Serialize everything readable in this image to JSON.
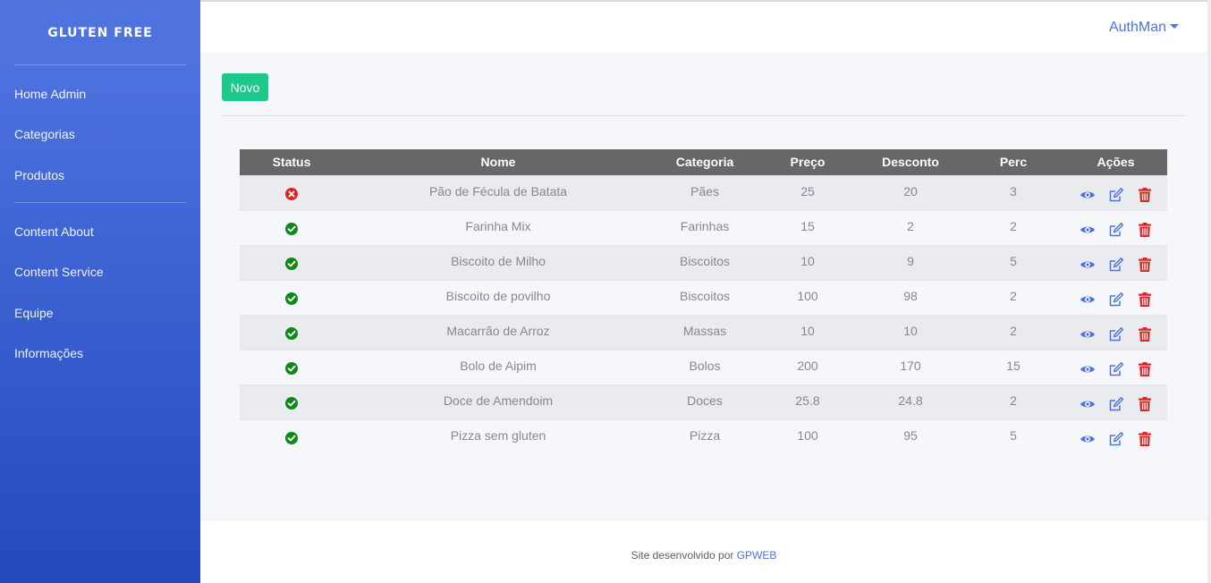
{
  "brand": "GLUTEN FREE",
  "sidebar": {
    "items": [
      {
        "label": "Home Admin"
      },
      {
        "label": "Categorias"
      },
      {
        "label": "Produtos"
      },
      {
        "label": "Content About"
      },
      {
        "label": "Content Service"
      },
      {
        "label": "Equipe"
      },
      {
        "label": "Informações"
      }
    ]
  },
  "topbar": {
    "user": "AuthMan"
  },
  "toolbar": {
    "new_label": "Novo"
  },
  "table": {
    "columns": [
      "Status",
      "Nome",
      "Categoria",
      "Preço",
      "Desconto",
      "Perc",
      "Ações"
    ],
    "rows": [
      {
        "status": "inactive",
        "nome": "Pão de Fécula de Batata",
        "categoria": "Pães",
        "preco": "25",
        "desconto": "20",
        "perc": "3"
      },
      {
        "status": "active",
        "nome": "Farinha Mix",
        "categoria": "Farinhas",
        "preco": "15",
        "desconto": "2",
        "perc": "2"
      },
      {
        "status": "active",
        "nome": "Biscoito de Milho",
        "categoria": "Biscoitos",
        "preco": "10",
        "desconto": "9",
        "perc": "5"
      },
      {
        "status": "active",
        "nome": "Biscoito de povilho",
        "categoria": "Biscoitos",
        "preco": "100",
        "desconto": "98",
        "perc": "2"
      },
      {
        "status": "active",
        "nome": "Macarrão de Arroz",
        "categoria": "Massas",
        "preco": "10",
        "desconto": "10",
        "perc": "2"
      },
      {
        "status": "active",
        "nome": "Bolo de Aipim",
        "categoria": "Bolos",
        "preco": "200",
        "desconto": "170",
        "perc": "15"
      },
      {
        "status": "active",
        "nome": "Doce de Amendoim",
        "categoria": "Doces",
        "preco": "25.8",
        "desconto": "24.8",
        "perc": "2"
      },
      {
        "status": "active",
        "nome": "Pizza sem gluten",
        "categoria": "Pizza",
        "preco": "100",
        "desconto": "95",
        "perc": "5"
      }
    ]
  },
  "icons": {
    "status_active": "check-circle-icon",
    "status_inactive": "times-circle-icon",
    "view": "eye-icon",
    "edit": "edit-icon",
    "delete": "trash-icon"
  },
  "colors": {
    "sidebar_top": "#4e73df",
    "sidebar_bottom": "#224abe",
    "primary": "#4e73df",
    "success_button": "#1cc88a",
    "status_active": "#0e8a16",
    "status_inactive": "#e02424",
    "delete": "#e02424",
    "table_header": "#676767"
  },
  "footer": {
    "text": "Site desenvolvido por ",
    "link": "GPWEB"
  }
}
